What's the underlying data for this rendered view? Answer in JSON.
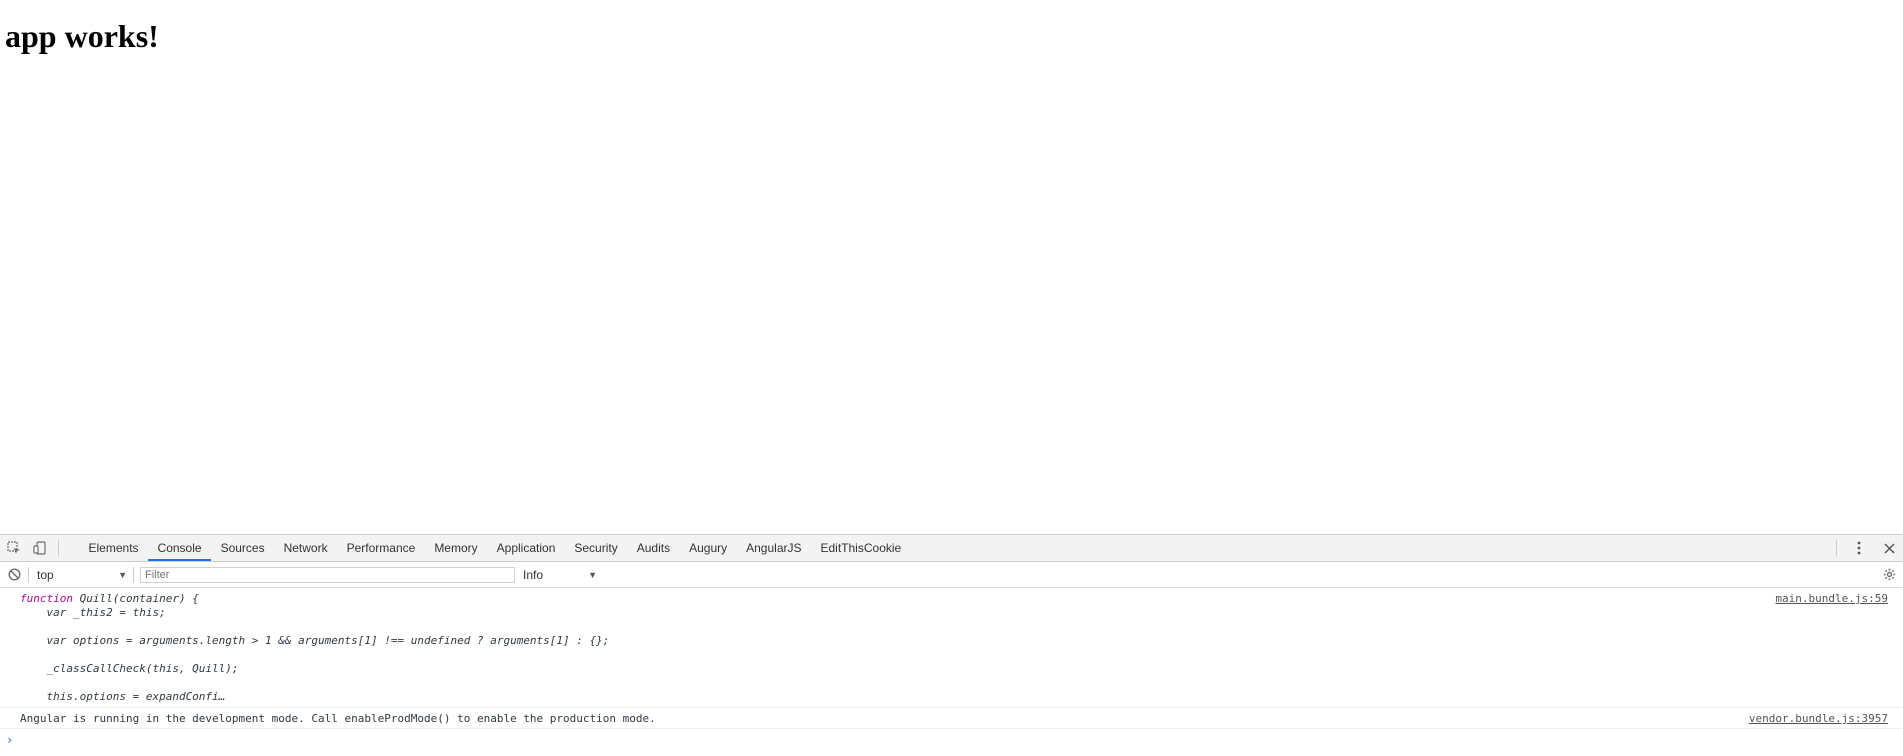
{
  "page": {
    "heading": "app works!"
  },
  "devtools": {
    "tabs": [
      {
        "label": "Elements"
      },
      {
        "label": "Console"
      },
      {
        "label": "Sources"
      },
      {
        "label": "Network"
      },
      {
        "label": "Performance"
      },
      {
        "label": "Memory"
      },
      {
        "label": "Application"
      },
      {
        "label": "Security"
      },
      {
        "label": "Audits"
      },
      {
        "label": "Augury"
      },
      {
        "label": "AngularJS"
      },
      {
        "label": "EditThisCookie"
      }
    ],
    "active_tab": "Console",
    "filterbar": {
      "context": "top",
      "filter_placeholder": "Filter",
      "level": "Info"
    },
    "messages": [
      {
        "source": "main.bundle.js:59",
        "keyword": "function",
        "header_rest": " Quill(container) {",
        "lines": [
          "    var _this2 = this;",
          "",
          "    var options = arguments.length > 1 && arguments[1] !== undefined ? arguments[1] : {};",
          "",
          "    _classCallCheck(this, Quill);",
          "",
          "    this.options = expandConfi…"
        ]
      },
      {
        "source": "vendor.bundle.js:3957",
        "text": "Angular is running in the development mode. Call enableProdMode() to enable the production mode."
      }
    ],
    "prompt_symbol": "›"
  }
}
